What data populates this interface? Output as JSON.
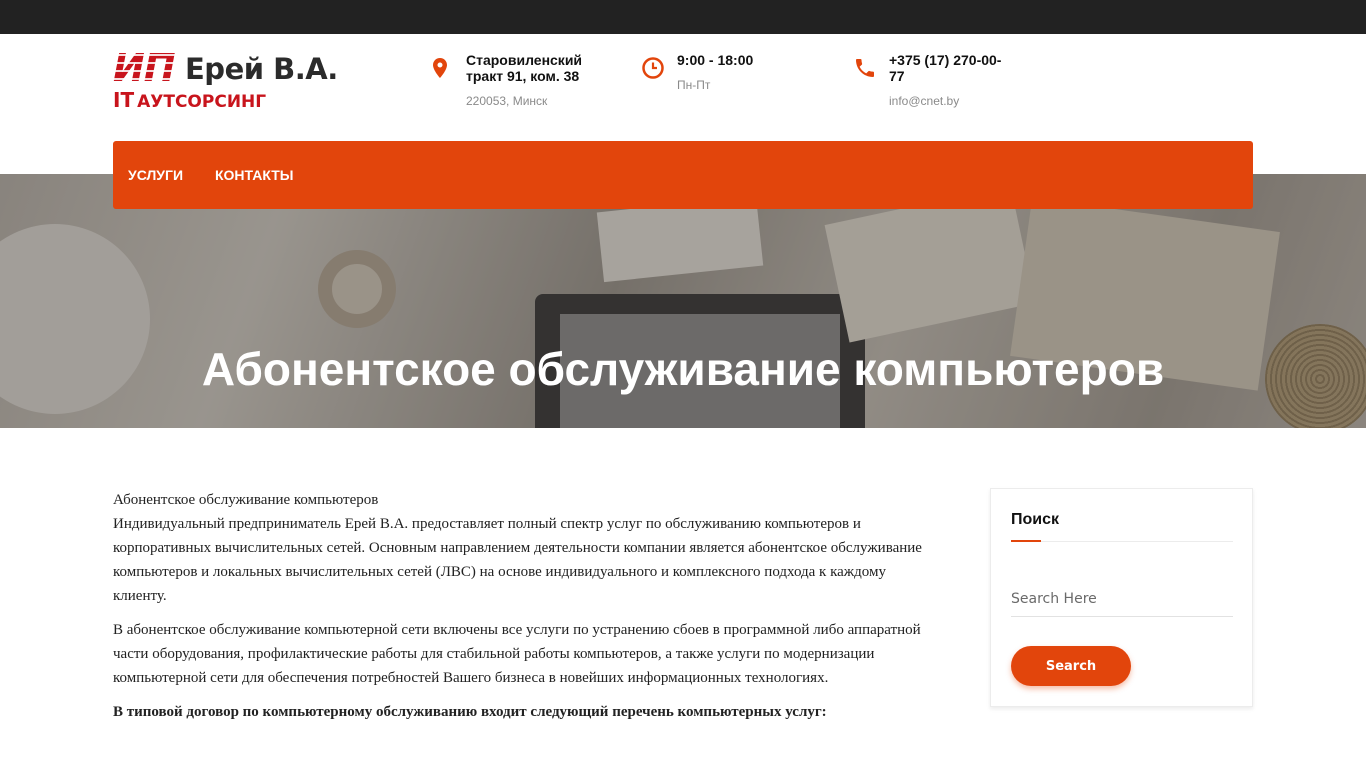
{
  "header": {
    "logo": {
      "ip": "ИП",
      "name": "Ерей В.А.",
      "sub_it": "IT",
      "sub_text": "АУТСОРСИНГ"
    },
    "address": {
      "line1": "Старовиленский",
      "line2": "тракт 91, ком. 38",
      "sub": "220053, Минск",
      "icon": "map-pin-icon"
    },
    "hours": {
      "title": "9:00 - 18:00",
      "sub": "Пн-Пт",
      "icon": "clock-icon"
    },
    "phone": {
      "line1": "+375 (17) 270-00-",
      "line2": "77",
      "sub": "info@cnet.by",
      "icon": "phone-icon"
    }
  },
  "nav": {
    "items": [
      {
        "label": "УСЛУГИ"
      },
      {
        "label": "КОНТАКТЫ"
      }
    ]
  },
  "hero": {
    "title": "Абонентское обслуживание компьютеров"
  },
  "content": {
    "p1_line1": "Абонентское обслуживание компьютеров",
    "p1_rest": "Индивидуальный предприниматель Ерей В.А. предоставляет полный спектр услуг по обслуживанию компьютеров и корпоративных вычислительных сетей. Основным направлением деятельности компании является абонентское обслуживание компьютеров и локальных вычислительных сетей (ЛВС) на основе индивидуального и комплексного подхода к каждому клиенту.",
    "p2": "В абонентское обслуживание компьютерной сети включены все услуги по устранению сбоев в программной либо аппаратной части оборудования, профилактические работы для стабильной работы компьютеров, а также услуги по модернизации компьютерной сети для обеспечения потребностей Вашего бизнеса в новейших информационных технологиях.",
    "p3": "В типовой договор по компьютерному обслуживанию входит следующий перечень компьютерных услуг:"
  },
  "sidebar": {
    "title": "Поиск",
    "search_placeholder": "Search Here",
    "search_button": "Search"
  },
  "colors": {
    "accent": "#e2450c",
    "logo_red": "#c8141c",
    "topbar": "#222222"
  }
}
